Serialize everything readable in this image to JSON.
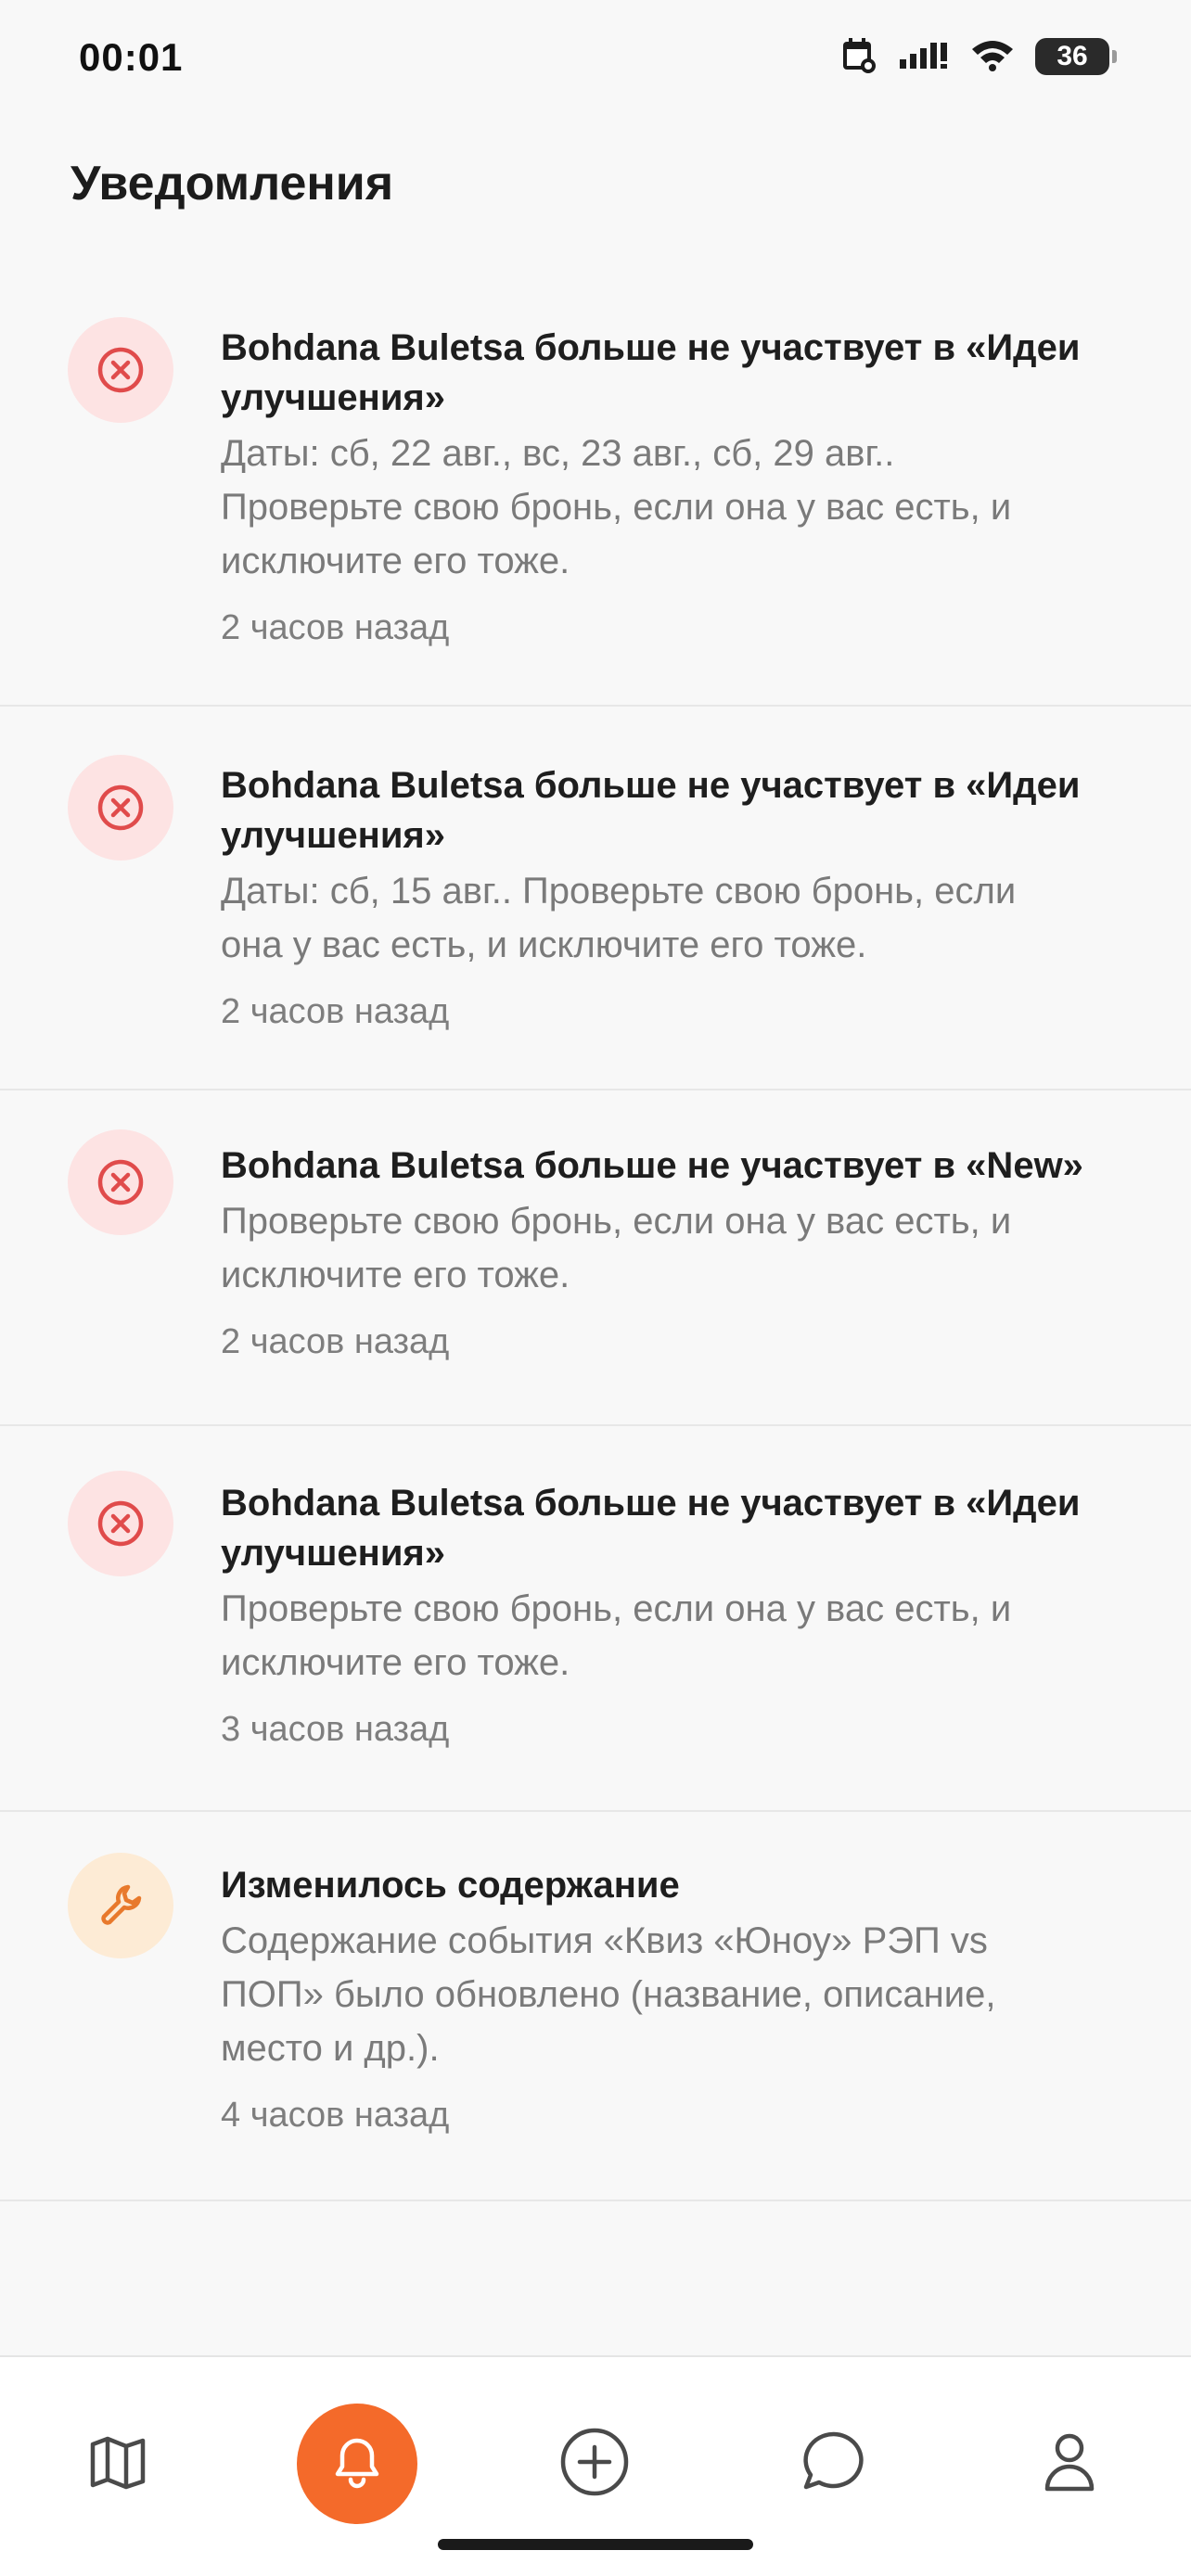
{
  "status_bar": {
    "time": "00:01",
    "battery": "36"
  },
  "page": {
    "title": "Уведомления"
  },
  "notifications": [
    {
      "icon": "cancel-icon",
      "title_line1": "Bohdana Buletsa больше не участвует в «Идеи",
      "title_line2": "улучшения»",
      "body_lines": [
        "Даты: сб, 22 авг., вс, 23 авг., сб, 29 авг..",
        "Проверьте свою бронь, если она у вас есть, и",
        "исключите его тоже."
      ],
      "time": "2 часов назад"
    },
    {
      "icon": "cancel-icon",
      "title_line1": "Bohdana Buletsa больше не участвует в «Идеи",
      "title_line2": "улучшения»",
      "body_lines": [
        "Даты: сб, 15 авг.. Проверьте свою бронь, если",
        "она у вас есть, и исключите его тоже."
      ],
      "time": "2 часов назад"
    },
    {
      "icon": "cancel-icon",
      "title_line1": "Bohdana Buletsa больше не участвует в «New»",
      "title_line2": "",
      "body_lines": [
        "Проверьте свою бронь, если она у вас есть, и",
        "исключите его тоже."
      ],
      "time": "2 часов назад"
    },
    {
      "icon": "cancel-icon",
      "title_line1": "Bohdana Buletsa больше не участвует в «Идеи",
      "title_line2": "улучшения»",
      "body_lines": [
        "Проверьте свою бронь, если она у вас есть, и",
        "исключите его тоже."
      ],
      "time": "3 часов назад"
    },
    {
      "icon": "wrench-icon",
      "title_line1": "Изменилось содержание",
      "title_line2": "",
      "body_lines": [
        "Содержание события «Квиз «Юноу» РЭП vs",
        "ПОП» было обновлено (название, описание,",
        "место и др.)."
      ],
      "time": "4 часов назад"
    }
  ],
  "bottom_nav": {
    "items": [
      "map-icon",
      "bell-icon",
      "add-icon",
      "chat-icon",
      "profile-icon"
    ],
    "active": "bell-icon",
    "accent_color": "#f46a2a"
  },
  "colors": {
    "error_icon": "#e04b4b",
    "warning_icon": "#e8792c"
  }
}
